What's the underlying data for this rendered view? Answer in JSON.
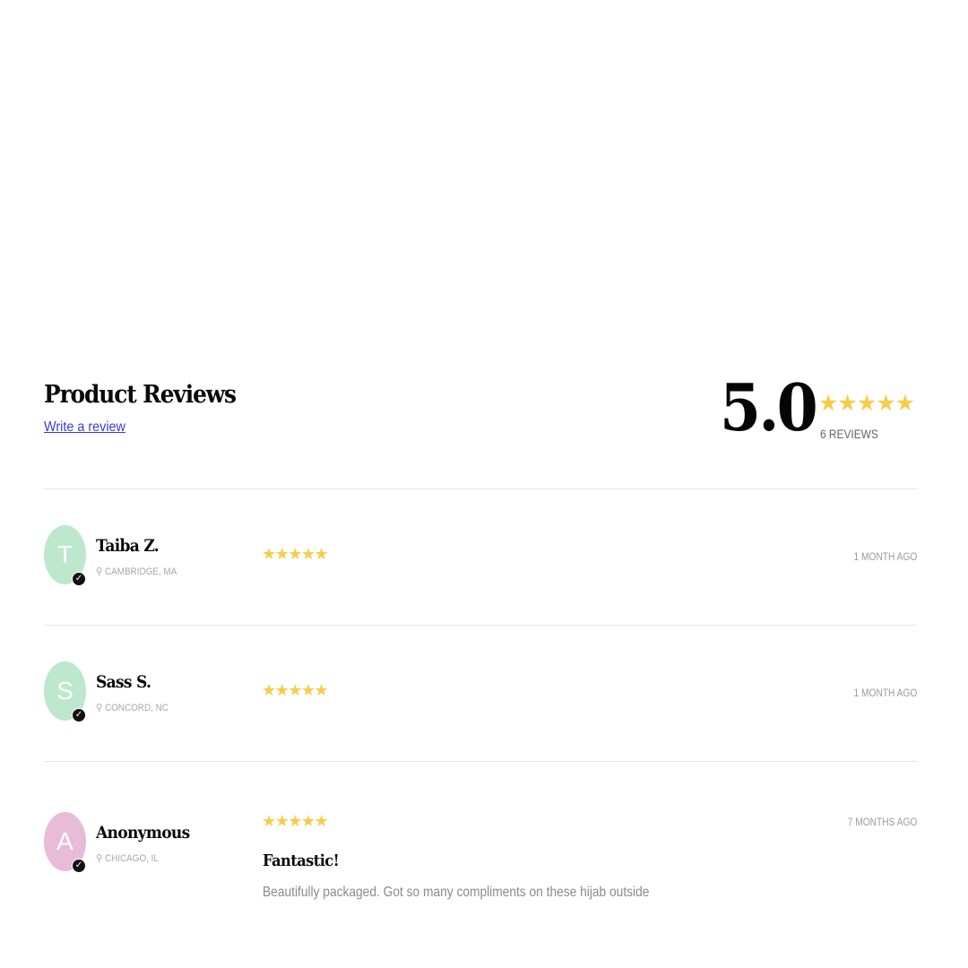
{
  "header": {
    "title": "Product Reviews",
    "write_review_label": "Write a review"
  },
  "summary": {
    "average_rating": "5.0",
    "stars": "★★★★★",
    "rating_value": 5,
    "review_count_label": "6 REVIEWS"
  },
  "colors": {
    "star": "#f7cd48",
    "link": "#3b3bd9",
    "avatar_mint": "#bde8cd",
    "avatar_pink": "#e8bcd8"
  },
  "reviews": [
    {
      "avatar_initial": "T",
      "name": "Taiba Z.",
      "location": "CAMBRIDGE, MA",
      "stars": "★★★★★",
      "rating": 5,
      "time_ago": "1 MONTH AGO"
    },
    {
      "avatar_initial": "S",
      "name": "Sass S.",
      "location": "CONCORD, NC",
      "stars": "★★★★★",
      "rating": 5,
      "time_ago": "1 MONTH AGO"
    },
    {
      "avatar_initial": "A",
      "name": "Anonymous",
      "location": "CHICAGO, IL",
      "stars": "★★★★★",
      "rating": 5,
      "time_ago": "7 MONTHS AGO",
      "title": "Fantastic!",
      "body": "Beautifully packaged. Got so many compliments on these hijab outside"
    }
  ],
  "icons": {
    "verified": "verified-check-icon",
    "location": "map-pin-icon",
    "star": "star-icon"
  }
}
